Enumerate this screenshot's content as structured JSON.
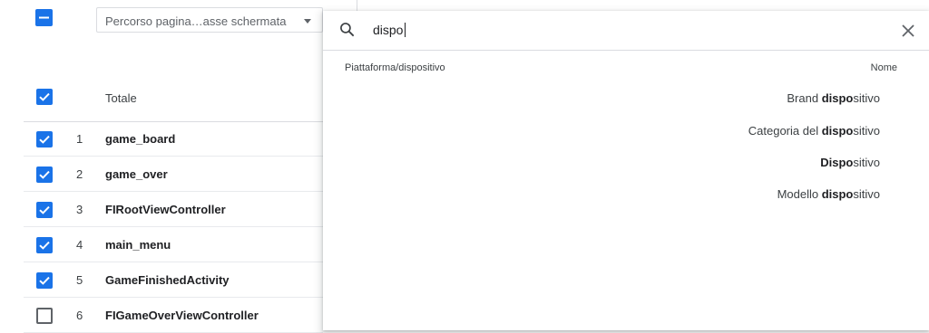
{
  "dimension_select": {
    "label": "Percorso pagina…asse schermata"
  },
  "table": {
    "total_label": "Totale",
    "rows": [
      {
        "index": "1",
        "name": "game_board",
        "checked": true
      },
      {
        "index": "2",
        "name": "game_over",
        "checked": true
      },
      {
        "index": "3",
        "name": "FIRootViewController",
        "checked": true
      },
      {
        "index": "4",
        "name": "main_menu",
        "checked": true
      },
      {
        "index": "5",
        "name": "GameFinishedActivity",
        "checked": true
      },
      {
        "index": "6",
        "name": "FIGameOverViewController",
        "checked": false
      }
    ]
  },
  "search": {
    "value": "dispo",
    "placeholder": ""
  },
  "results": {
    "category_header": "Piattaforma/dispositivo",
    "name_header": "Nome",
    "items": [
      {
        "prefix": "Brand ",
        "match": "dispo",
        "suffix": "sitivo"
      },
      {
        "prefix": "Categoria del ",
        "match": "dispo",
        "suffix": "sitivo"
      },
      {
        "prefix": "",
        "match": "Dispo",
        "suffix": "sitivo"
      },
      {
        "prefix": "Modello ",
        "match": "dispo",
        "suffix": "sitivo"
      }
    ]
  },
  "colors": {
    "accent": "#1a73e8",
    "border": "#dadce0",
    "text": "#202124"
  }
}
